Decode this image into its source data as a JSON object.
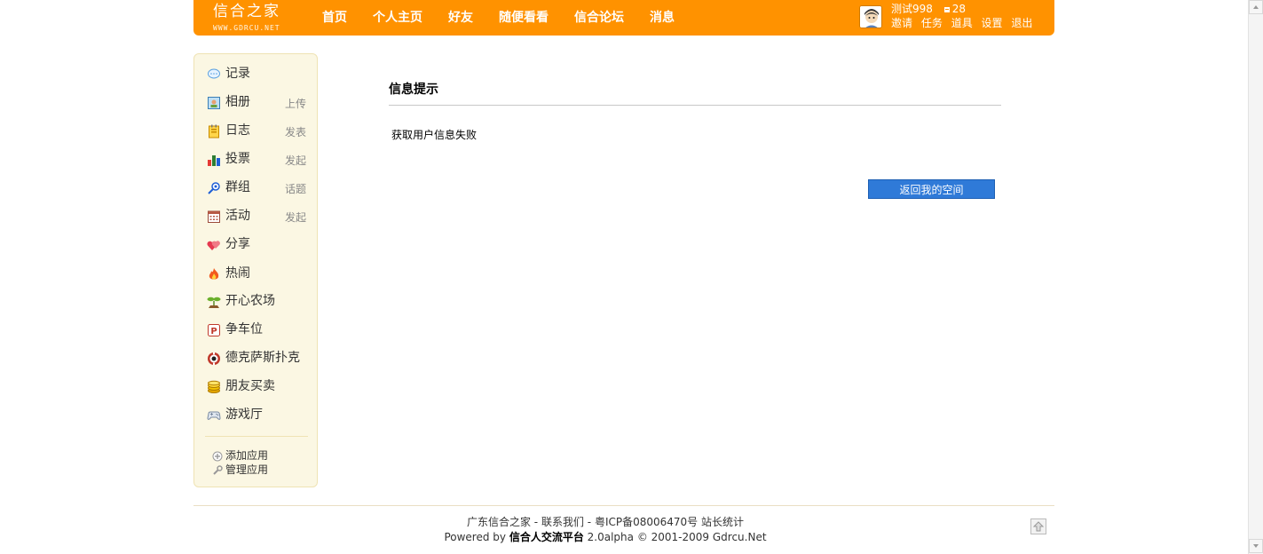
{
  "header": {
    "logo_text": "信合之家",
    "logo_sub": "WWW.GDRCU.NET",
    "nav": [
      "首页",
      "个人主页",
      "好友",
      "随便看看",
      "信合论坛",
      "消息"
    ],
    "user": {
      "name": "测试998",
      "count_icon": "coin-icon",
      "count": "28",
      "links": [
        "邀请",
        "任务",
        "道具",
        "设置",
        "退出"
      ]
    }
  },
  "sidebar": {
    "apps": [
      {
        "label": "记录",
        "icon": "speech-bubble-icon",
        "action": ""
      },
      {
        "label": "相册",
        "icon": "photo-album-icon",
        "action": "上传"
      },
      {
        "label": "日志",
        "icon": "notebook-icon",
        "action": "发表"
      },
      {
        "label": "投票",
        "icon": "bar-chart-icon",
        "action": "发起"
      },
      {
        "label": "群组",
        "icon": "group-icon",
        "action": "话题"
      },
      {
        "label": "活动",
        "icon": "calendar-icon",
        "action": "发起"
      },
      {
        "label": "分享",
        "icon": "hearts-icon",
        "action": ""
      },
      {
        "label": "热闹",
        "icon": "fire-icon",
        "action": ""
      },
      {
        "label": "开心农场",
        "icon": "sprout-icon",
        "action": ""
      },
      {
        "label": "争车位",
        "icon": "parking-icon",
        "action": ""
      },
      {
        "label": "德克萨斯扑克",
        "icon": "poker-chip-icon",
        "action": ""
      },
      {
        "label": "朋友买卖",
        "icon": "coins-icon",
        "action": ""
      },
      {
        "label": "游戏厅",
        "icon": "gamepad-icon",
        "action": ""
      }
    ],
    "manage": [
      {
        "label": "添加应用",
        "icon": "plus-icon"
      },
      {
        "label": "管理应用",
        "icon": "wrench-icon"
      }
    ]
  },
  "main": {
    "title": "信息提示",
    "message": "获取用户信息失败",
    "button": "返回我的空间"
  },
  "footer": {
    "line1": {
      "site": "广东信合之家",
      "sep1": " - ",
      "contact": "联系我们",
      "sep2": " - ",
      "icp": "粤ICP备08006470号",
      "stats": "站长统计"
    },
    "line2": {
      "prefix": "Powered by ",
      "platform": "信合人交流平台",
      "suffix": " 2.0alpha © 2001-2009 Gdrcu.Net"
    }
  },
  "colors": {
    "header_bg": "#ff9200",
    "sidebar_bg": "#fbf7e3",
    "button_bg": "#2f7ad8"
  }
}
